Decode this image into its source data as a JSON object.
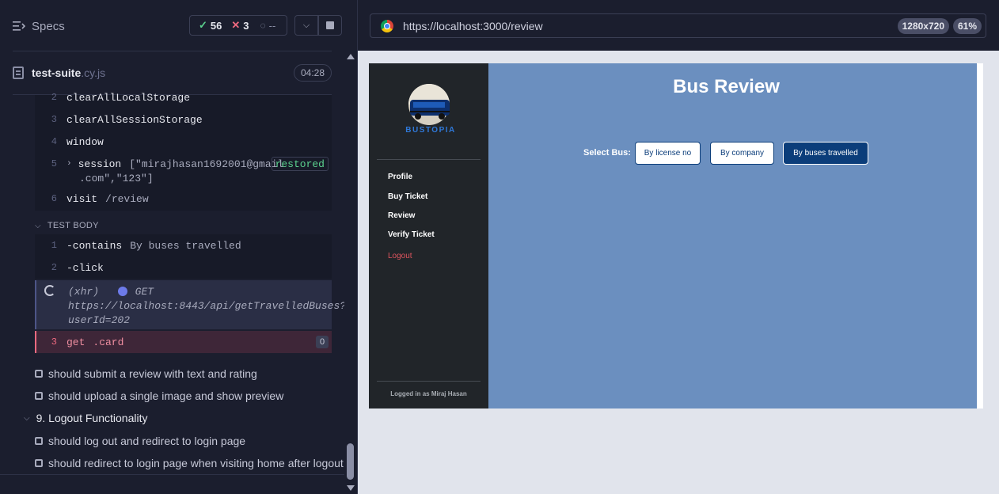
{
  "reporter": {
    "specs_label": "Specs",
    "stats": {
      "passed": "56",
      "failed": "3",
      "pending": "--"
    },
    "file": {
      "name": "test-suite",
      "ext": ".cy.js",
      "duration": "04:28"
    },
    "before_commands": [
      {
        "num": "2",
        "name": "clearAllLocalStorage",
        "arg": ""
      },
      {
        "num": "3",
        "name": "clearAllSessionStorage",
        "arg": ""
      },
      {
        "num": "4",
        "name": "window",
        "arg": ""
      },
      {
        "num": "5",
        "name": "session",
        "arg": "[\"mirajhasan1692001@gmail",
        "arg2": ".com\",\"123\"]",
        "badge": "restored"
      },
      {
        "num": "6",
        "name": "visit",
        "arg": "/review"
      }
    ],
    "test_body_label": "TEST BODY",
    "body_commands": [
      {
        "num": "1",
        "name": "-contains",
        "arg": "By buses travelled"
      },
      {
        "num": "2",
        "name": "-click",
        "arg": ""
      }
    ],
    "xhr": {
      "label": "(xhr)",
      "method": "GET",
      "url_line1": "https://localhost:8443/api/getTravelledBuses?",
      "url_line2": "userId=202"
    },
    "failed_command": {
      "num": "3",
      "name": "get",
      "arg": ".card",
      "count": "0"
    },
    "tests": [
      "should submit a review with text and rating",
      "should upload a single image and show preview"
    ],
    "suite2": {
      "title": "9. Logout Functionality",
      "tests": [
        "should log out and redirect to login page",
        "should redirect to login page when visiting home after logout"
      ]
    }
  },
  "browser": {
    "url": "https://localhost:3000/review",
    "viewport": "1280x720",
    "zoom": "61%"
  },
  "app": {
    "brand": "BUSTOPIA",
    "nav": [
      "Profile",
      "Buy Ticket",
      "Review",
      "Verify Ticket"
    ],
    "logout": "Logout",
    "logged_in": "Logged in as Miraj Hasan",
    "title": "Bus Review",
    "select_label": "Select Bus:",
    "buttons": [
      "By license no",
      "By company",
      "By buses travelled"
    ]
  },
  "colors": {
    "pass": "#5bd18e",
    "fail": "#ef6a80",
    "app_main_bg": "#6b8fbf",
    "app_sidebar_bg": "#212529",
    "active_button": "#0b3d7a"
  }
}
